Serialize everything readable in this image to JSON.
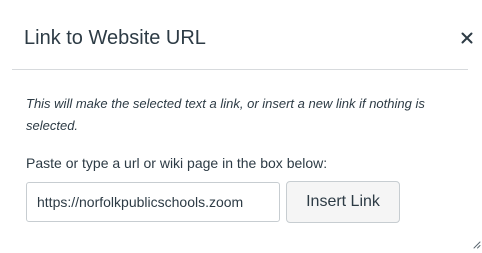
{
  "dialog": {
    "title": "Link to Website URL",
    "close_icon": "close-icon",
    "description": "This will make the selected text a link, or insert a new link if nothing is selected.",
    "prompt": "Paste or type a url or wiki page in the box below:",
    "url_value": "https://norfolkpublicschools.zoom",
    "insert_button_label": "Insert Link",
    "resize_icon": "resize-grip-icon"
  }
}
